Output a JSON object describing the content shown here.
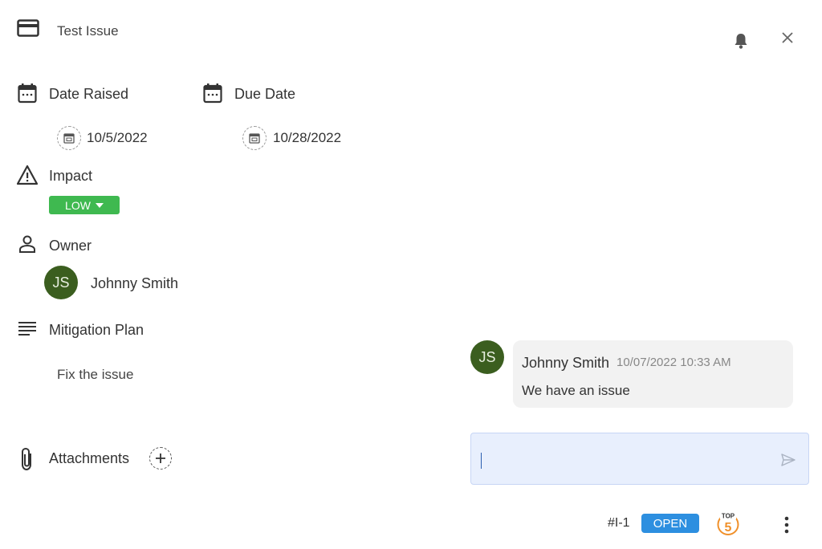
{
  "header": {
    "title": "Test Issue",
    "icons": [
      "card-icon",
      "bell-icon",
      "close-icon"
    ]
  },
  "dates": {
    "raised_label": "Date Raised",
    "raised_value": "10/5/2022",
    "due_label": "Due Date",
    "due_value": "10/28/2022"
  },
  "impact": {
    "label": "Impact",
    "value": "LOW",
    "color": "#3fb950"
  },
  "owner": {
    "label": "Owner",
    "initials": "JS",
    "name": "Johnny Smith"
  },
  "mitigation": {
    "label": "Mitigation Plan",
    "text": "Fix the issue"
  },
  "attachments": {
    "label": "Attachments"
  },
  "comments": [
    {
      "initials": "JS",
      "author": "Johnny Smith",
      "timestamp": "10/07/2022 10:33 AM",
      "text": "We have an issue"
    }
  ],
  "comment_input": {
    "value": ""
  },
  "footer": {
    "issue_id": "#I-1",
    "status": "OPEN",
    "status_color": "#2d8fe0",
    "top5_label": "TOP",
    "top5_number": "5"
  }
}
